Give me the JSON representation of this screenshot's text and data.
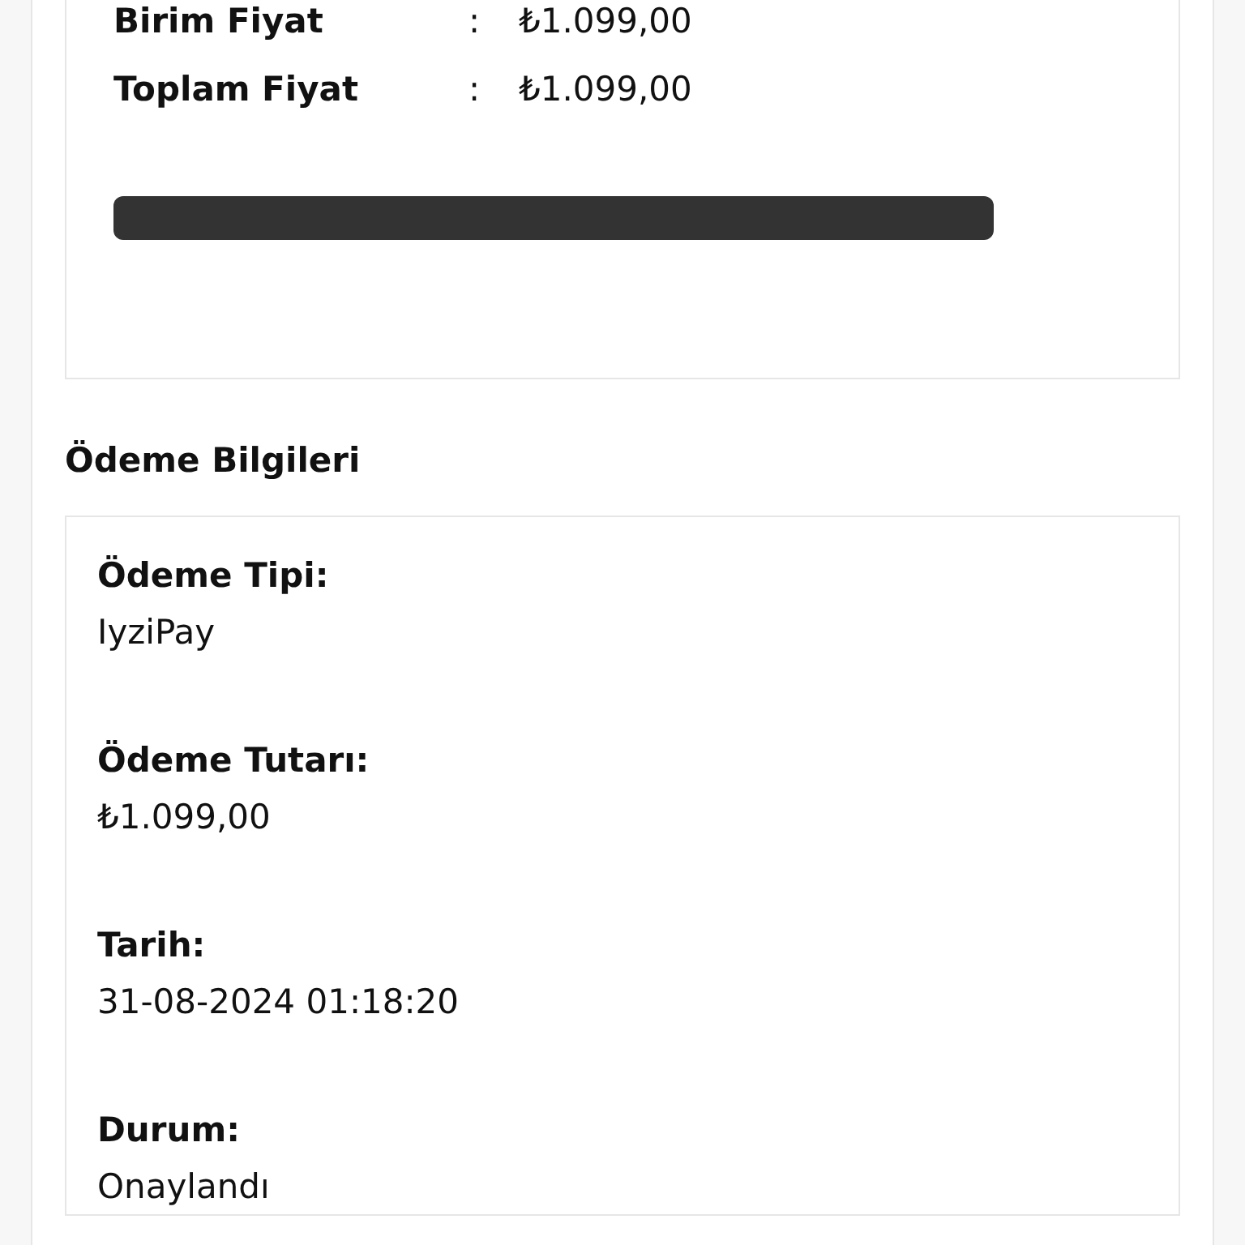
{
  "price_rows": [
    {
      "label": "Birim Fiyat",
      "separator": ":",
      "value": "₺1.099,00"
    },
    {
      "label": "Toplam Fiyat",
      "separator": ":",
      "value": "₺1.099,00"
    }
  ],
  "payment": {
    "title": "Ödeme Bilgileri",
    "fields": [
      {
        "label": "Ödeme Tipi:",
        "value": "IyziPay"
      },
      {
        "label": "Ödeme Tutarı:",
        "value": "₺1.099,00"
      },
      {
        "label": "Tarih:",
        "value": "31-08-2024 01:18:20"
      },
      {
        "label": "Durum:",
        "value": "Onaylandı"
      }
    ]
  }
}
